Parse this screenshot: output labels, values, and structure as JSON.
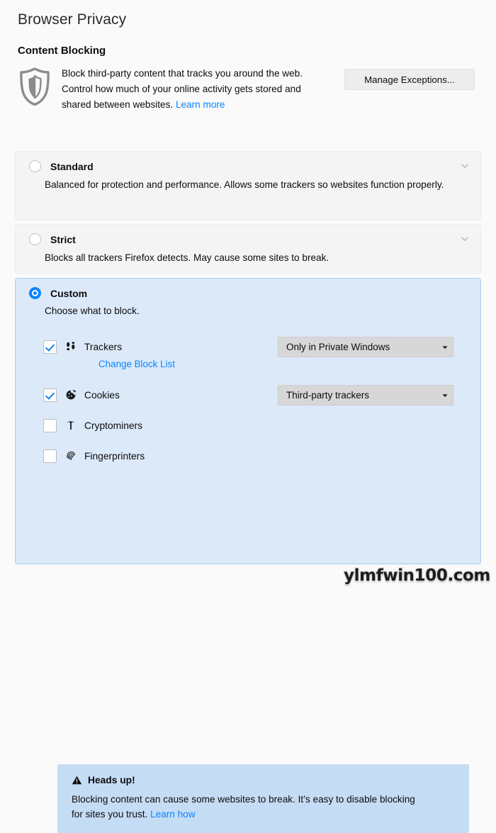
{
  "header": {
    "page_title": "Browser Privacy",
    "section_title": "Content Blocking"
  },
  "intro": {
    "shield_icon": "shield-icon",
    "description": "Block third-party content that tracks you around the web. Control how much of your online activity gets stored and shared between websites. ",
    "learn_more_label": "Learn more",
    "manage_exceptions_label": "Manage Exceptions..."
  },
  "options": [
    {
      "id": "standard",
      "label": "Standard",
      "description": "Balanced for protection and performance. Allows some trackers so websites function properly.",
      "selected": false,
      "expand_icon": "chevron-down-icon"
    },
    {
      "id": "strict",
      "label": "Strict",
      "description": "Blocks all trackers Firefox detects. May cause some sites to break.",
      "selected": false,
      "expand_icon": "chevron-down-icon"
    }
  ],
  "custom": {
    "label": "Custom",
    "selected": true,
    "sub_label": "Choose what to block.",
    "items": [
      {
        "id": "trackers",
        "label": "Trackers",
        "icon": "footprints-icon",
        "checked": true
      },
      {
        "id": "cookies",
        "label": "Cookies",
        "icon": "cookie-icon",
        "checked": true
      },
      {
        "id": "cryptominers",
        "label": "Cryptominers",
        "icon": "pickaxe-icon",
        "checked": false
      },
      {
        "id": "fingerprinters",
        "label": "Fingerprinters",
        "icon": "fingerprint-icon",
        "checked": false
      }
    ],
    "change_block_list_label": "Change Block List",
    "dropdowns": [
      {
        "id": "trackers-scope",
        "value": "Only in Private Windows",
        "arrow_icon": "dropdown-arrow-icon"
      },
      {
        "id": "cookies-scope",
        "value": "Third-party trackers",
        "arrow_icon": "dropdown-arrow-icon"
      }
    ],
    "heads_up": {
      "icon": "warning-triangle-icon",
      "title": "Heads up!",
      "body": "Blocking content can cause some websites to break. It’s easy to disable blocking for sites you trust. ",
      "learn_how_label": "Learn how"
    }
  },
  "watermark": "ylmfwin100.com",
  "colors": {
    "page_bg": "#fafafa",
    "panel_bg": "#f4f4f4",
    "custom_bg": "#dce9f9",
    "custom_border": "#a8cbf0",
    "headsup_bg": "#c5dcf5",
    "accent": "#0a84ff",
    "link": "#0a84ff",
    "text": "#0c0c0d",
    "dropdown_bg": "#d7d7d7",
    "button_bg": "#ededed"
  }
}
